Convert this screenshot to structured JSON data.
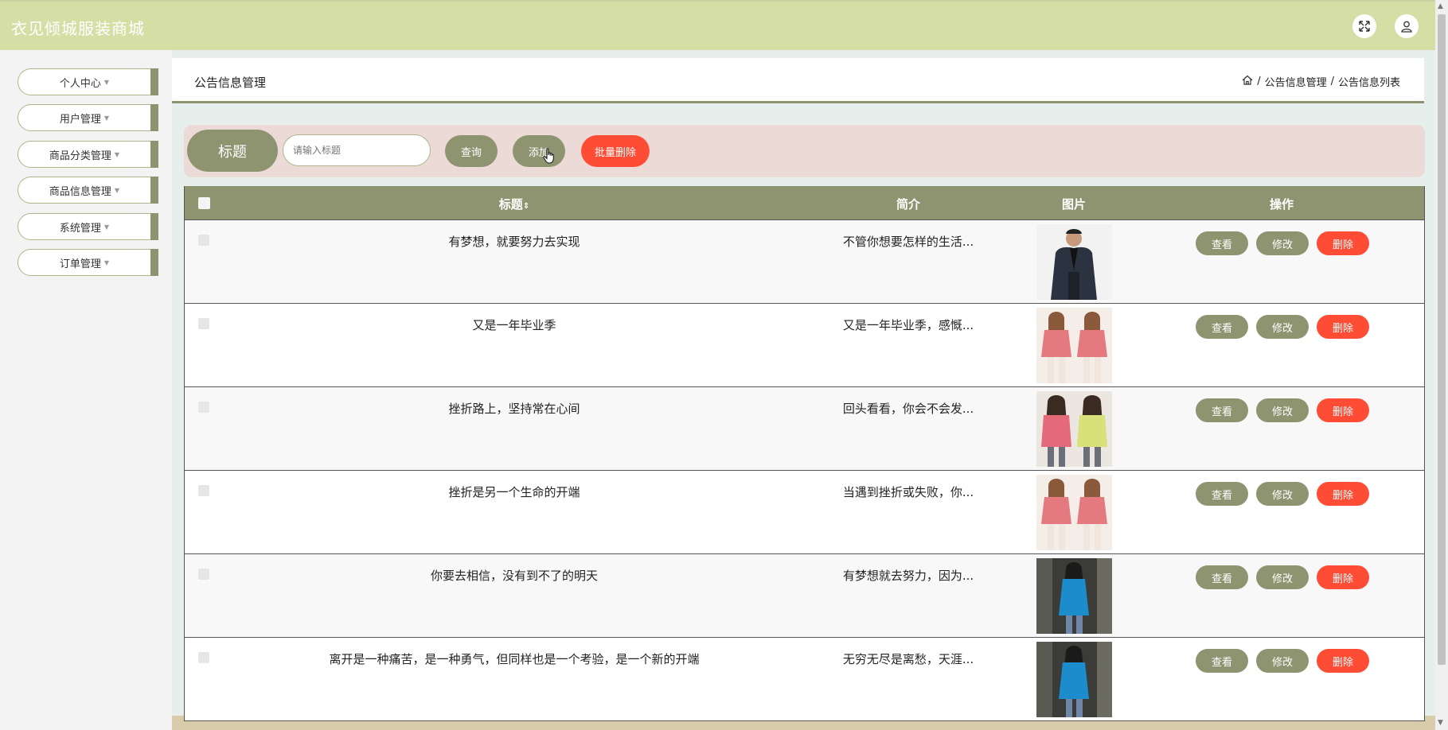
{
  "app": {
    "title": "衣见倾城服装商城"
  },
  "sidebar": {
    "items": [
      {
        "label": "个人中心"
      },
      {
        "label": "用户管理"
      },
      {
        "label": "商品分类管理"
      },
      {
        "label": "商品信息管理"
      },
      {
        "label": "系统管理"
      },
      {
        "label": "订单管理"
      }
    ]
  },
  "page": {
    "title": "公告信息管理",
    "breadcrumb": [
      "公告信息管理",
      "公告信息列表"
    ],
    "breadcrumb_sep": "/"
  },
  "search": {
    "label": "标题",
    "placeholder": "请输入标题",
    "query_label": "查询",
    "add_label": "添加",
    "batch_delete_label": "批量删除"
  },
  "table": {
    "headers": {
      "title": "标题",
      "sort_icon": "⇕",
      "intro": "简介",
      "image": "图片",
      "actions": "操作"
    },
    "action_labels": {
      "view": "查看",
      "edit": "修改",
      "delete": "删除"
    },
    "rows": [
      {
        "title": "有梦想，就要努力去实现",
        "intro": "不管你想要怎样的生活...",
        "image": "man-dark-jacket"
      },
      {
        "title": "又是一年毕业季",
        "intro": "又是一年毕业季，感慨...",
        "image": "two-women-pink"
      },
      {
        "title": "挫折路上，坚持常在心间",
        "intro": "回头看看，你会不会发...",
        "image": "two-women-pink-yellow"
      },
      {
        "title": "挫折是另一个生命的开端",
        "intro": "当遇到挫折或失败，你...",
        "image": "two-women-pink"
      },
      {
        "title": "你要去相信，没有到不了的明天",
        "intro": "有梦想就去努力，因为...",
        "image": "woman-blue-dress"
      },
      {
        "title": "离开是一种痛苦，是一种勇气，但同样也是一个考验，是一个新的开端",
        "intro": "无穷无尽是离愁，天涯...",
        "image": "woman-blue-dress"
      }
    ]
  },
  "colors": {
    "accent": "#8e9470",
    "danger": "#ff4c35",
    "topbar": "#d4dea5",
    "search_bg": "#ecdad6"
  }
}
